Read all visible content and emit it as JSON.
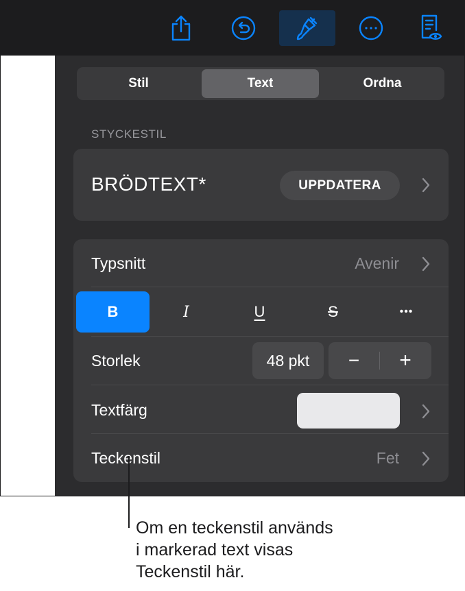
{
  "toolbar": {
    "buttons": [
      {
        "name": "share-icon"
      },
      {
        "name": "undo-icon"
      },
      {
        "name": "paintbrush-icon",
        "active": true
      },
      {
        "name": "more-icon"
      },
      {
        "name": "reading-view-icon"
      }
    ],
    "accent": "#0a84ff"
  },
  "tabs": {
    "items": [
      "Stil",
      "Text",
      "Ordna"
    ],
    "selected": "Text"
  },
  "paragraph_style": {
    "section_title": "STYCKESTIL",
    "name": "BRÖDTEXT*",
    "update_label": "UPPDATERA"
  },
  "font": {
    "label": "Typsnitt",
    "value": "Avenir"
  },
  "format_buttons": {
    "bold": "B",
    "italic": "I",
    "underline": "U",
    "strikethrough": "S",
    "more": "•••",
    "bold_active": true
  },
  "size": {
    "label": "Storlek",
    "value": "48 pkt",
    "decrease_symbol": "−",
    "increase_symbol": "+"
  },
  "text_color": {
    "label": "Textfärg",
    "swatch_color": "#e9e9eb"
  },
  "character_style": {
    "label": "Teckenstil",
    "value": "Fet"
  },
  "callout": {
    "text": "Om en teckenstil används\ni markerad text visas\nTeckenstil här."
  }
}
